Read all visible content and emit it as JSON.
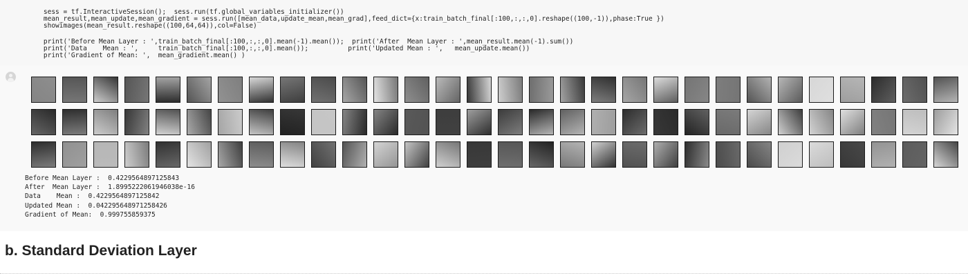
{
  "code_cell": {
    "lines": [
      "    sess = tf.InteractiveSession();  sess.run(tf.global_variables_initializer())",
      "    mean_result,mean_update,mean_gradient = sess.run([mean_data,update_mean,mean_grad],feed_dict={x:train_batch_final[:100,:,:,0].reshape((100,-1)),phase:True })",
      "    showimages(mean_result.reshape((100,64,64)),col=False)",
      "",
      "    print('Before Mean Layer : ',train_batch_final[:100,:,:,0].mean(-1).mean());  print('After  Mean Layer : ',mean_result.mean(-1).sum())",
      "    print('Data    Mean : ',     train_batch_final[:100,:,:,0].mean());          print('Updated Mean : ',   mean_update.mean())",
      "    print('Gradient of Mean: ',  mean_gradient.mean() )"
    ]
  },
  "output": {
    "icon": "user-avatar-icon",
    "image_rows": 3,
    "images_per_row": 30,
    "text_lines": [
      "Before Mean Layer :  0.4229564897125843",
      "After  Mean Layer :  1.8995222061946038e-16",
      "Data    Mean :  0.4229564897125842",
      "Updated Mean :  0.042295648971258426",
      "Gradient of Mean:  0.999755859375"
    ]
  },
  "section": {
    "heading": "b. Standard Deviation Layer"
  }
}
